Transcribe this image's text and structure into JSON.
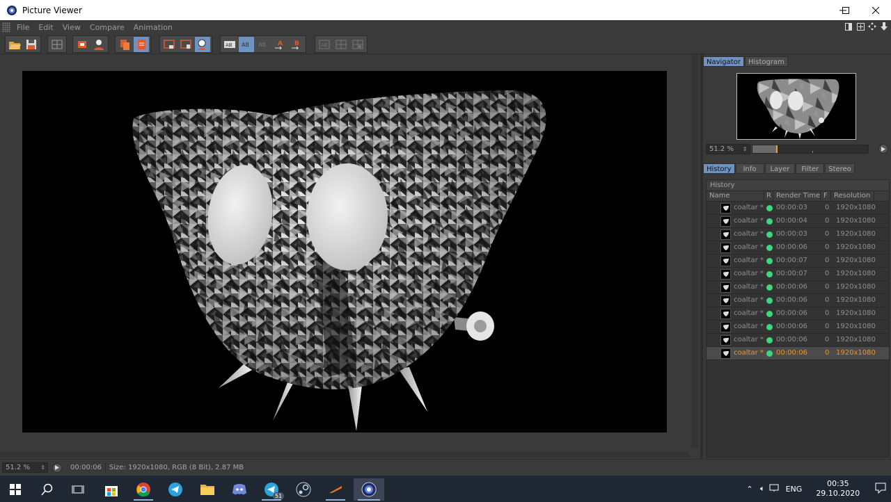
{
  "window": {
    "title": "Picture Viewer"
  },
  "menu": {
    "items": [
      "File",
      "Edit",
      "View",
      "Compare",
      "Animation"
    ]
  },
  "navigator": {
    "tabs": [
      "Navigator",
      "Histogram"
    ],
    "zoom": "51.2 %",
    "timeline_position": 0.2
  },
  "history_tabs": [
    "History",
    "Info",
    "Layer",
    "Filter",
    "Stereo"
  ],
  "history": {
    "header": "History",
    "columns": {
      "name": "Name",
      "r": "R",
      "render_time": "Render Time",
      "f": "F",
      "resolution": "Resolution"
    },
    "rows": [
      {
        "name": "coaltar *",
        "time": "00:00:03",
        "f": "0",
        "res": "1920x1080"
      },
      {
        "name": "coaltar *",
        "time": "00:00:04",
        "f": "0",
        "res": "1920x1080"
      },
      {
        "name": "coaltar *",
        "time": "00:00:03",
        "f": "0",
        "res": "1920x1080"
      },
      {
        "name": "coaltar *",
        "time": "00:00:06",
        "f": "0",
        "res": "1920x1080"
      },
      {
        "name": "coaltar *",
        "time": "00:00:07",
        "f": "0",
        "res": "1920x1080"
      },
      {
        "name": "coaltar *",
        "time": "00:00:07",
        "f": "0",
        "res": "1920x1080"
      },
      {
        "name": "coaltar *",
        "time": "00:00:06",
        "f": "0",
        "res": "1920x1080"
      },
      {
        "name": "coaltar *",
        "time": "00:00:06",
        "f": "0",
        "res": "1920x1080"
      },
      {
        "name": "coaltar *",
        "time": "00:00:06",
        "f": "0",
        "res": "1920x1080"
      },
      {
        "name": "coaltar *",
        "time": "00:00:06",
        "f": "0",
        "res": "1920x1080"
      },
      {
        "name": "coaltar *",
        "time": "00:00:06",
        "f": "0",
        "res": "1920x1080"
      },
      {
        "name": "coaltar *",
        "time": "00:00:06",
        "f": "0",
        "res": "1920x1080"
      }
    ]
  },
  "status": {
    "zoom": "51.2 %",
    "time": "00:00:06",
    "info": "Size: 1920x1080, RGB (8 Bit), 2.87 MB"
  },
  "taskbar": {
    "telegram_badge": "51",
    "lang": "ENG",
    "clock_time": "00:35",
    "clock_date": "29.10.2020"
  },
  "colors": {
    "accent_tab": "#6f93c0",
    "status_dot": "#3cd97a",
    "selected_row": "#e49a2b"
  }
}
